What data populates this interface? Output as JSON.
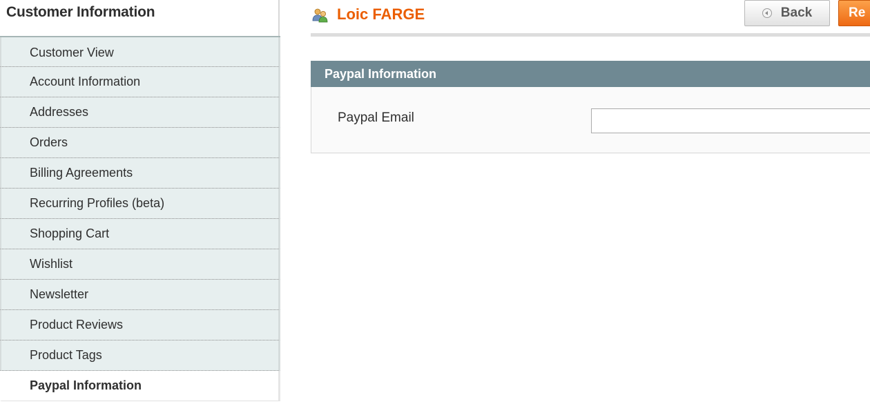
{
  "sidebar": {
    "title": "Customer Information",
    "tabs": [
      {
        "label": "Customer View"
      },
      {
        "label": "Account Information"
      },
      {
        "label": "Addresses"
      },
      {
        "label": "Orders"
      },
      {
        "label": "Billing Agreements"
      },
      {
        "label": "Recurring Profiles (beta)"
      },
      {
        "label": "Shopping Cart"
      },
      {
        "label": "Wishlist"
      },
      {
        "label": "Newsletter"
      },
      {
        "label": "Product Reviews"
      },
      {
        "label": "Product Tags"
      },
      {
        "label": "Paypal Information",
        "active": true
      }
    ]
  },
  "header": {
    "title": "Loic FARGE",
    "icon": "customer-icon",
    "back_label": "Back",
    "reset_label": "Re"
  },
  "section": {
    "title": "Paypal Information",
    "field_label": "Paypal Email",
    "field_value": ""
  },
  "colors": {
    "accent": "#eb5e00",
    "section_header": "#6f8993",
    "tab_bg": "#e7efef"
  }
}
